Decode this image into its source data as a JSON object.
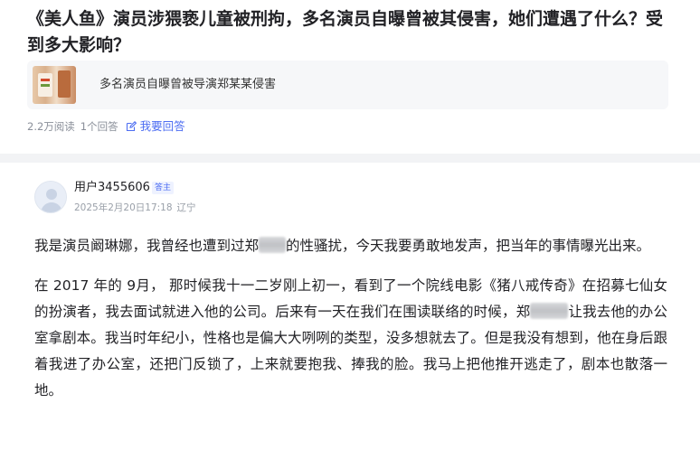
{
  "question": {
    "title": "《美人鱼》演员涉猥亵儿童被刑拘，多名演员自曝曾被其侵害，她们遭遇了什么？受到多大影响？",
    "topic_card_text": "多名演员自曝曾被导演郑某某侵害",
    "views": "2.2万阅读",
    "answers_count": "1个回答",
    "answer_link_label": "我要回答"
  },
  "answer": {
    "user_name": "用户3455606",
    "badge": "答主",
    "date": "2025年2月20日17:18",
    "location": "辽宁",
    "paragraphs": [
      {
        "part1": "我是演员阚琳娜，我曾经也遭到过郑",
        "part2": "的性骚扰，今天我要勇敢地发声，把当年的事情曝光出来。"
      },
      {
        "part1": "在 2017 年的 9月， 那时候我十一二岁刚上初一，看到了一个院线电影《猪八戒传奇》在招募七仙女的扮演者，我去面试就进入他的公司。后来有一天在我们在围读联络的时候，郑",
        "part2": "让我去他的办公室拿剧本。我当时年纪小，性格也是偏大大咧咧的类型，没多想就去了。但是我没有想到，他在身后跟着我进了办公室，还把门反锁了，上来就要抱我、捧我的脸。我马上把他推开逃走了，剧本也散落一地。"
      }
    ]
  },
  "colors": {
    "accent": "#4e6ef2",
    "muted": "#8a8f99",
    "text": "#222226",
    "card_bg": "#f6f7f9",
    "divider": "#f2f3f5"
  },
  "icons": {
    "answer_link": "edit-icon",
    "avatar": "default-user-avatar"
  }
}
